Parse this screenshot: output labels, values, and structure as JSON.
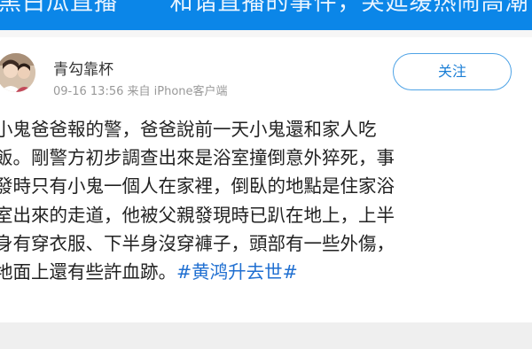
{
  "banner": {
    "left_text": "黑白瓜直播",
    "right_text": "和谐直播的事件，突延缓热闹高潮"
  },
  "post": {
    "username": "青勾靠杯",
    "meta": "09-16 13:56 来自 iPhone客户端",
    "follow_label": "关注",
    "lines": [
      "小鬼爸爸報的警，爸爸說前一天小鬼還和家人吃",
      "飯。剛警方初步調查出來是浴室撞倒意外猝死，事",
      "發時只有小鬼一個人在家裡，倒臥的地點是住家浴",
      "室出來的走道，他被父親發現時已趴在地上，上半",
      "身有穿衣服、下半身沒穿褲子，頭部有一些外傷，",
      "地面上還有些許血跡。"
    ],
    "hashtag": "#黄鸿升去世#"
  },
  "colors": {
    "banner": "#0b86e8",
    "link": "#1f6fd1",
    "follow_border": "#4ea3e6"
  }
}
